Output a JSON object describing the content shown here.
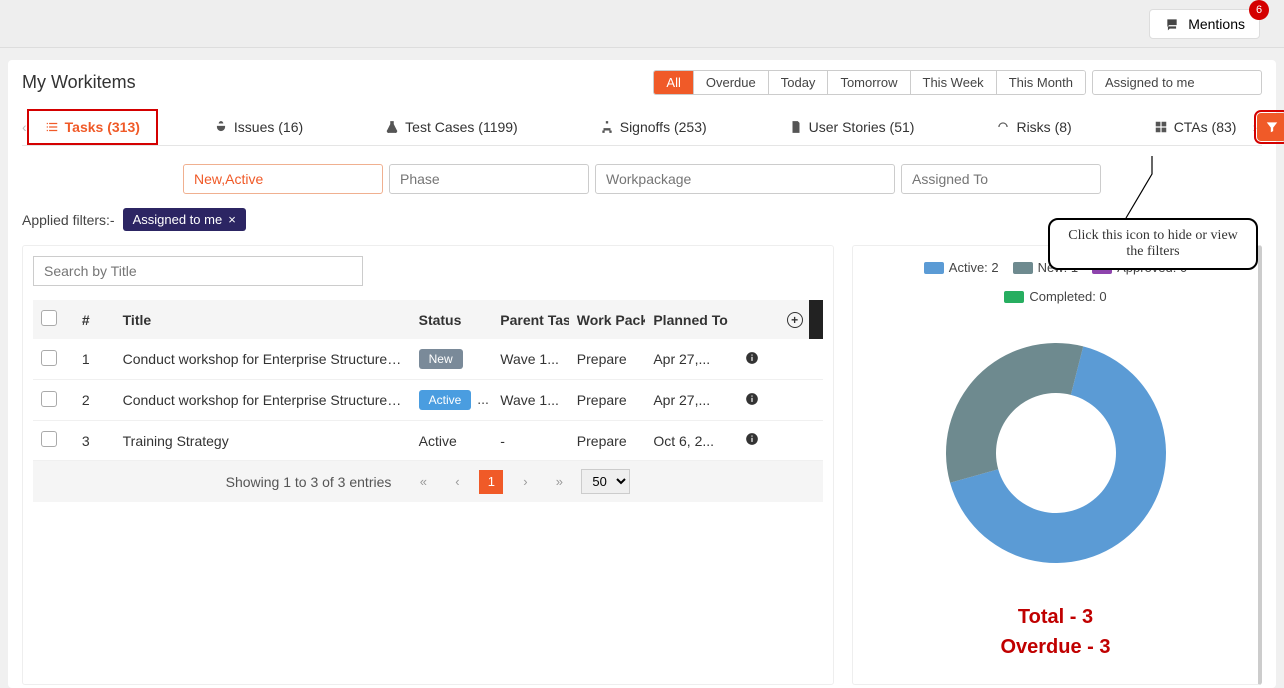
{
  "topbar": {
    "mentions_label": "Mentions",
    "notif_count": "6"
  },
  "page_title": "My Workitems",
  "time_filters": {
    "group": [
      "All",
      "Overdue",
      "Today",
      "Tomorrow",
      "This Week",
      "This Month"
    ],
    "active_index": 0,
    "assigned_label": "Assigned to me"
  },
  "tabs": [
    {
      "label": "Tasks (313)",
      "active": true
    },
    {
      "label": "Issues (16)"
    },
    {
      "label": "Test Cases (1199)"
    },
    {
      "label": "Signoffs (253)"
    },
    {
      "label": "User Stories (51)"
    },
    {
      "label": "Risks (8)"
    },
    {
      "label": "CTAs (83)"
    }
  ],
  "filter_inputs": {
    "status_val": "New,Active",
    "phase_placeholder": "Phase",
    "workpackage_placeholder": "Workpackage",
    "assigned_placeholder": "Assigned To"
  },
  "applied": {
    "prefix": "Applied filters:-",
    "chip": "Assigned to me"
  },
  "search_placeholder": "Search by Title",
  "table": {
    "headers": [
      "#",
      "Title",
      "Status",
      "Parent Tas",
      "Work Pack",
      "Planned To"
    ],
    "rows": [
      {
        "n": "1",
        "title": "Conduct workshop for Enterprise Structure an...",
        "status": "New",
        "status_cls": "status-new",
        "parent": "Wave 1...",
        "wp": "Prepare",
        "planned": "Apr 27,..."
      },
      {
        "n": "2",
        "title": "Conduct workshop for Enterprise Structure an...",
        "status": "Active",
        "status_cls": "status-active",
        "parent": "Wave 1...",
        "wp": "Prepare",
        "planned": "Apr 27,...",
        "status_ellip": "..."
      },
      {
        "n": "3",
        "title": "Training Strategy",
        "status": "Active",
        "status_cls": "",
        "parent": "-",
        "wp": "Prepare",
        "planned": "Oct 6, 2..."
      }
    ]
  },
  "pager": {
    "text": "Showing 1 to 3 of 3 entries",
    "page": "1",
    "size": "50"
  },
  "chart_data": {
    "type": "pie",
    "title": "",
    "series": [
      {
        "name": "Active",
        "value": 2,
        "color": "#5b9bd5"
      },
      {
        "name": "New",
        "value": 1,
        "color": "#6e8a8f"
      },
      {
        "name": "Approved",
        "value": 0,
        "color": "#8e44ad"
      },
      {
        "name": "Completed",
        "value": 0,
        "color": "#27ae60"
      }
    ],
    "legend": [
      {
        "label": "Active: 2",
        "color": "#5b9bd5"
      },
      {
        "label": "New: 1",
        "color": "#6e8a8f"
      },
      {
        "label": "Approved: 0",
        "color": "#8e44ad"
      },
      {
        "label": "Completed: 0",
        "color": "#27ae60"
      }
    ],
    "totals": {
      "total_label": "Total - 3",
      "overdue_label": "Overdue - 3"
    }
  },
  "callout_text": "Click this icon to hide or view the filters"
}
